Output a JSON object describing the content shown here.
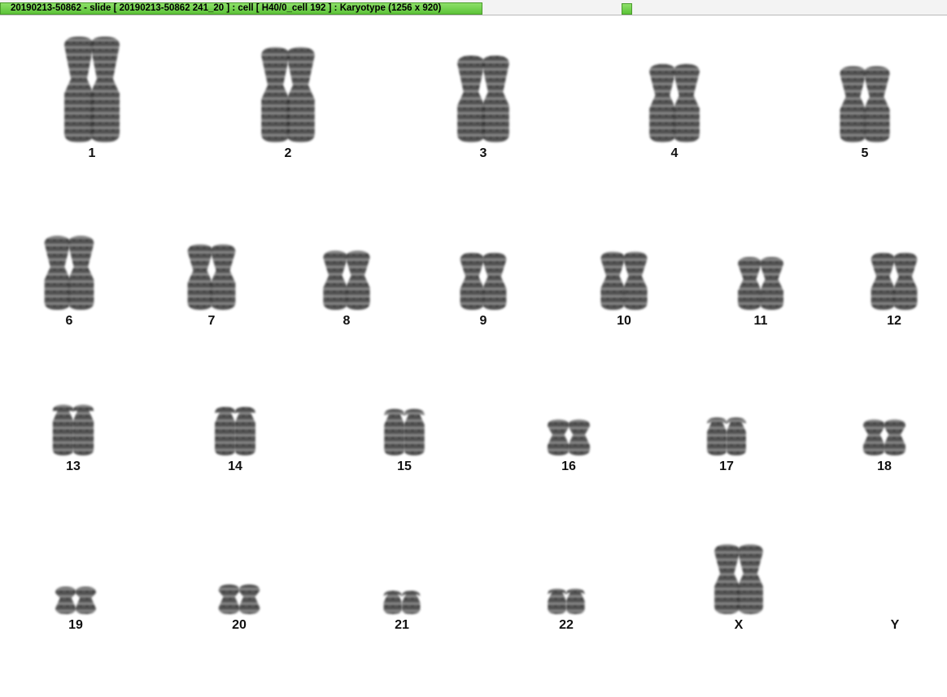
{
  "window": {
    "title": "20190213-50862 - slide [ 20190213-50862 241_20 ] : cell [ H40/0_cell 192 ] : Karyotype  (1256 x 920)"
  },
  "karyotype": {
    "pairs": [
      {
        "label": "1",
        "chromatids": 2,
        "size": 1.0,
        "shape": "tall"
      },
      {
        "label": "2",
        "chromatids": 2,
        "size": 0.9,
        "shape": "tall"
      },
      {
        "label": "3",
        "chromatids": 2,
        "size": 0.82,
        "shape": "x"
      },
      {
        "label": "4",
        "chromatids": 2,
        "size": 0.74,
        "shape": "tall"
      },
      {
        "label": "5",
        "chromatids": 2,
        "size": 0.72,
        "shape": "tall"
      },
      {
        "label": "6",
        "chromatids": 2,
        "size": 0.7,
        "shape": "x"
      },
      {
        "label": "7",
        "chromatids": 2,
        "size": 0.62,
        "shape": "tall"
      },
      {
        "label": "8",
        "chromatids": 2,
        "size": 0.56,
        "shape": "x"
      },
      {
        "label": "9",
        "chromatids": 2,
        "size": 0.54,
        "shape": "x"
      },
      {
        "label": "10",
        "chromatids": 2,
        "size": 0.55,
        "shape": "x"
      },
      {
        "label": "11",
        "chromatids": 2,
        "size": 0.5,
        "shape": "x"
      },
      {
        "label": "12",
        "chromatids": 2,
        "size": 0.54,
        "shape": "x"
      },
      {
        "label": "13",
        "chromatids": 2,
        "size": 0.48,
        "shape": "acro"
      },
      {
        "label": "14",
        "chromatids": 2,
        "size": 0.46,
        "shape": "acro"
      },
      {
        "label": "15",
        "chromatids": 2,
        "size": 0.44,
        "shape": "acro"
      },
      {
        "label": "16",
        "chromatids": 2,
        "size": 0.34,
        "shape": "x"
      },
      {
        "label": "17",
        "chromatids": 2,
        "size": 0.36,
        "shape": "acro"
      },
      {
        "label": "18",
        "chromatids": 2,
        "size": 0.34,
        "shape": "x"
      },
      {
        "label": "19",
        "chromatids": 2,
        "size": 0.26,
        "shape": "x"
      },
      {
        "label": "20",
        "chromatids": 2,
        "size": 0.28,
        "shape": "x"
      },
      {
        "label": "21",
        "chromatids": 2,
        "size": 0.22,
        "shape": "acro"
      },
      {
        "label": "22",
        "chromatids": 2,
        "size": 0.24,
        "shape": "acro"
      },
      {
        "label": "X",
        "chromatids": 2,
        "size": 0.66,
        "shape": "x"
      },
      {
        "label": "Y",
        "chromatids": 0,
        "size": 0.0,
        "shape": "none"
      }
    ]
  },
  "colors": {
    "accent_green": "#5cc338",
    "chromosome": "#2a2a2a"
  }
}
